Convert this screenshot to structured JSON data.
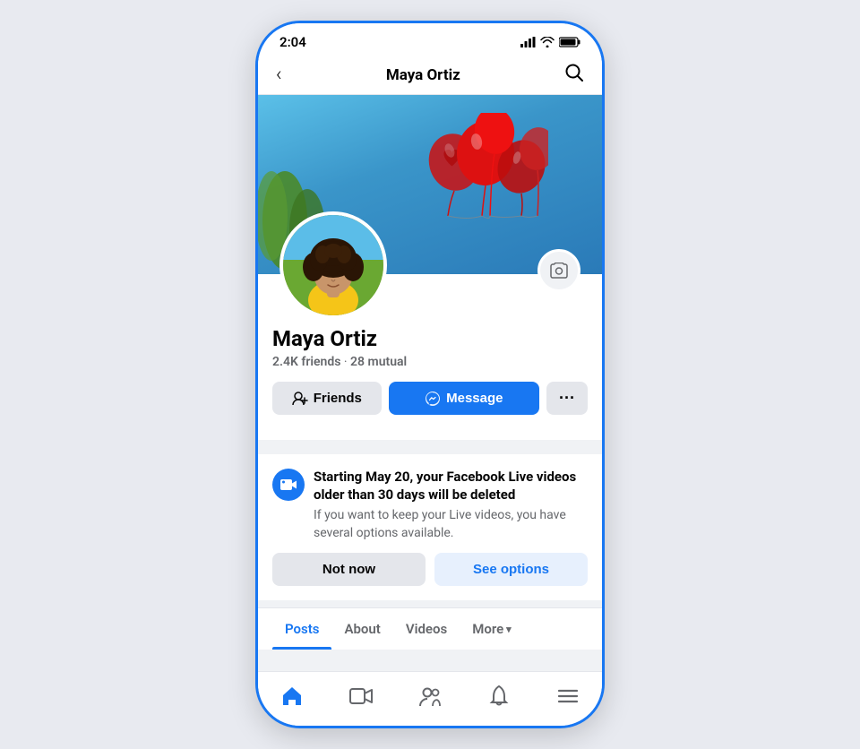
{
  "status": {
    "time": "2:04"
  },
  "nav": {
    "back_label": "‹",
    "title": "Maya Ortiz",
    "search_label": "🔍"
  },
  "profile": {
    "name": "Maya Ortiz",
    "friends_count": "2.4K",
    "friends_label": "friends",
    "mutual_count": "28",
    "mutual_label": "mutual"
  },
  "buttons": {
    "friends_label": "Friends",
    "message_label": "Message",
    "more_dots": "···"
  },
  "notification": {
    "title": "Starting May 20, your Facebook Live videos older than 30 days will be deleted",
    "body": "If you want to keep your Live videos, you have several options available.",
    "not_now": "Not now",
    "see_options": "See options"
  },
  "tabs": [
    {
      "id": "posts",
      "label": "Posts",
      "active": true
    },
    {
      "id": "about",
      "label": "About",
      "active": false
    },
    {
      "id": "videos",
      "label": "Videos",
      "active": false
    },
    {
      "id": "more",
      "label": "More",
      "active": false
    }
  ],
  "bottom_nav": [
    {
      "id": "home",
      "icon": "home",
      "active": true
    },
    {
      "id": "video",
      "icon": "video",
      "active": false
    },
    {
      "id": "people",
      "icon": "people",
      "active": false
    },
    {
      "id": "bell",
      "icon": "bell",
      "active": false
    },
    {
      "id": "menu",
      "icon": "menu",
      "active": false
    }
  ]
}
